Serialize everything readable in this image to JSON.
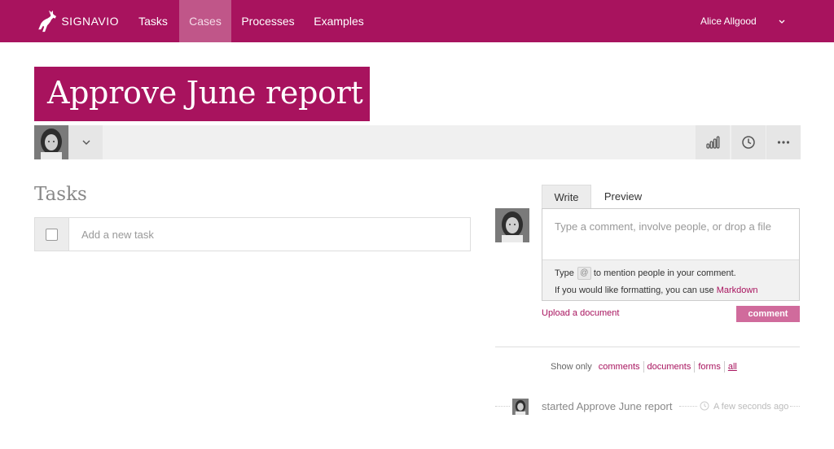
{
  "brand": {
    "name": "SIGNAVIO",
    "color": "#a8135e"
  },
  "nav": {
    "items": [
      {
        "label": "Tasks",
        "active": false
      },
      {
        "label": "Cases",
        "active": true
      },
      {
        "label": "Processes",
        "active": false
      },
      {
        "label": "Examples",
        "active": false
      }
    ],
    "user_name": "Alice Allgood",
    "user_menu_icon": "chevron-down-icon"
  },
  "case": {
    "title": "Approve June report"
  },
  "toolbar": {
    "assignee_icon": "avatar",
    "dropdown_icon": "chevron-down-icon",
    "actions": [
      "bar-chart-icon",
      "clock-icon",
      "more-icon"
    ]
  },
  "tasks": {
    "heading": "Tasks",
    "new_task_placeholder": "Add a new task"
  },
  "comment": {
    "tabs": [
      "Write",
      "Preview"
    ],
    "active_tab": "Write",
    "placeholder": "Type a comment, involve people, or drop a file",
    "help_prefix": "Type",
    "help_at": "@",
    "help_suffix": "to mention people in your comment.",
    "help_format": "If you would like formatting, you can use",
    "help_markdown": "Markdown",
    "upload_label": "Upload a document",
    "submit_label": "comment"
  },
  "filter": {
    "prefix": "Show only",
    "options": [
      "comments",
      "documents",
      "forms",
      "all"
    ],
    "active": "all"
  },
  "activity": [
    {
      "text": "started Approve June report",
      "time": "A few seconds ago"
    }
  ]
}
